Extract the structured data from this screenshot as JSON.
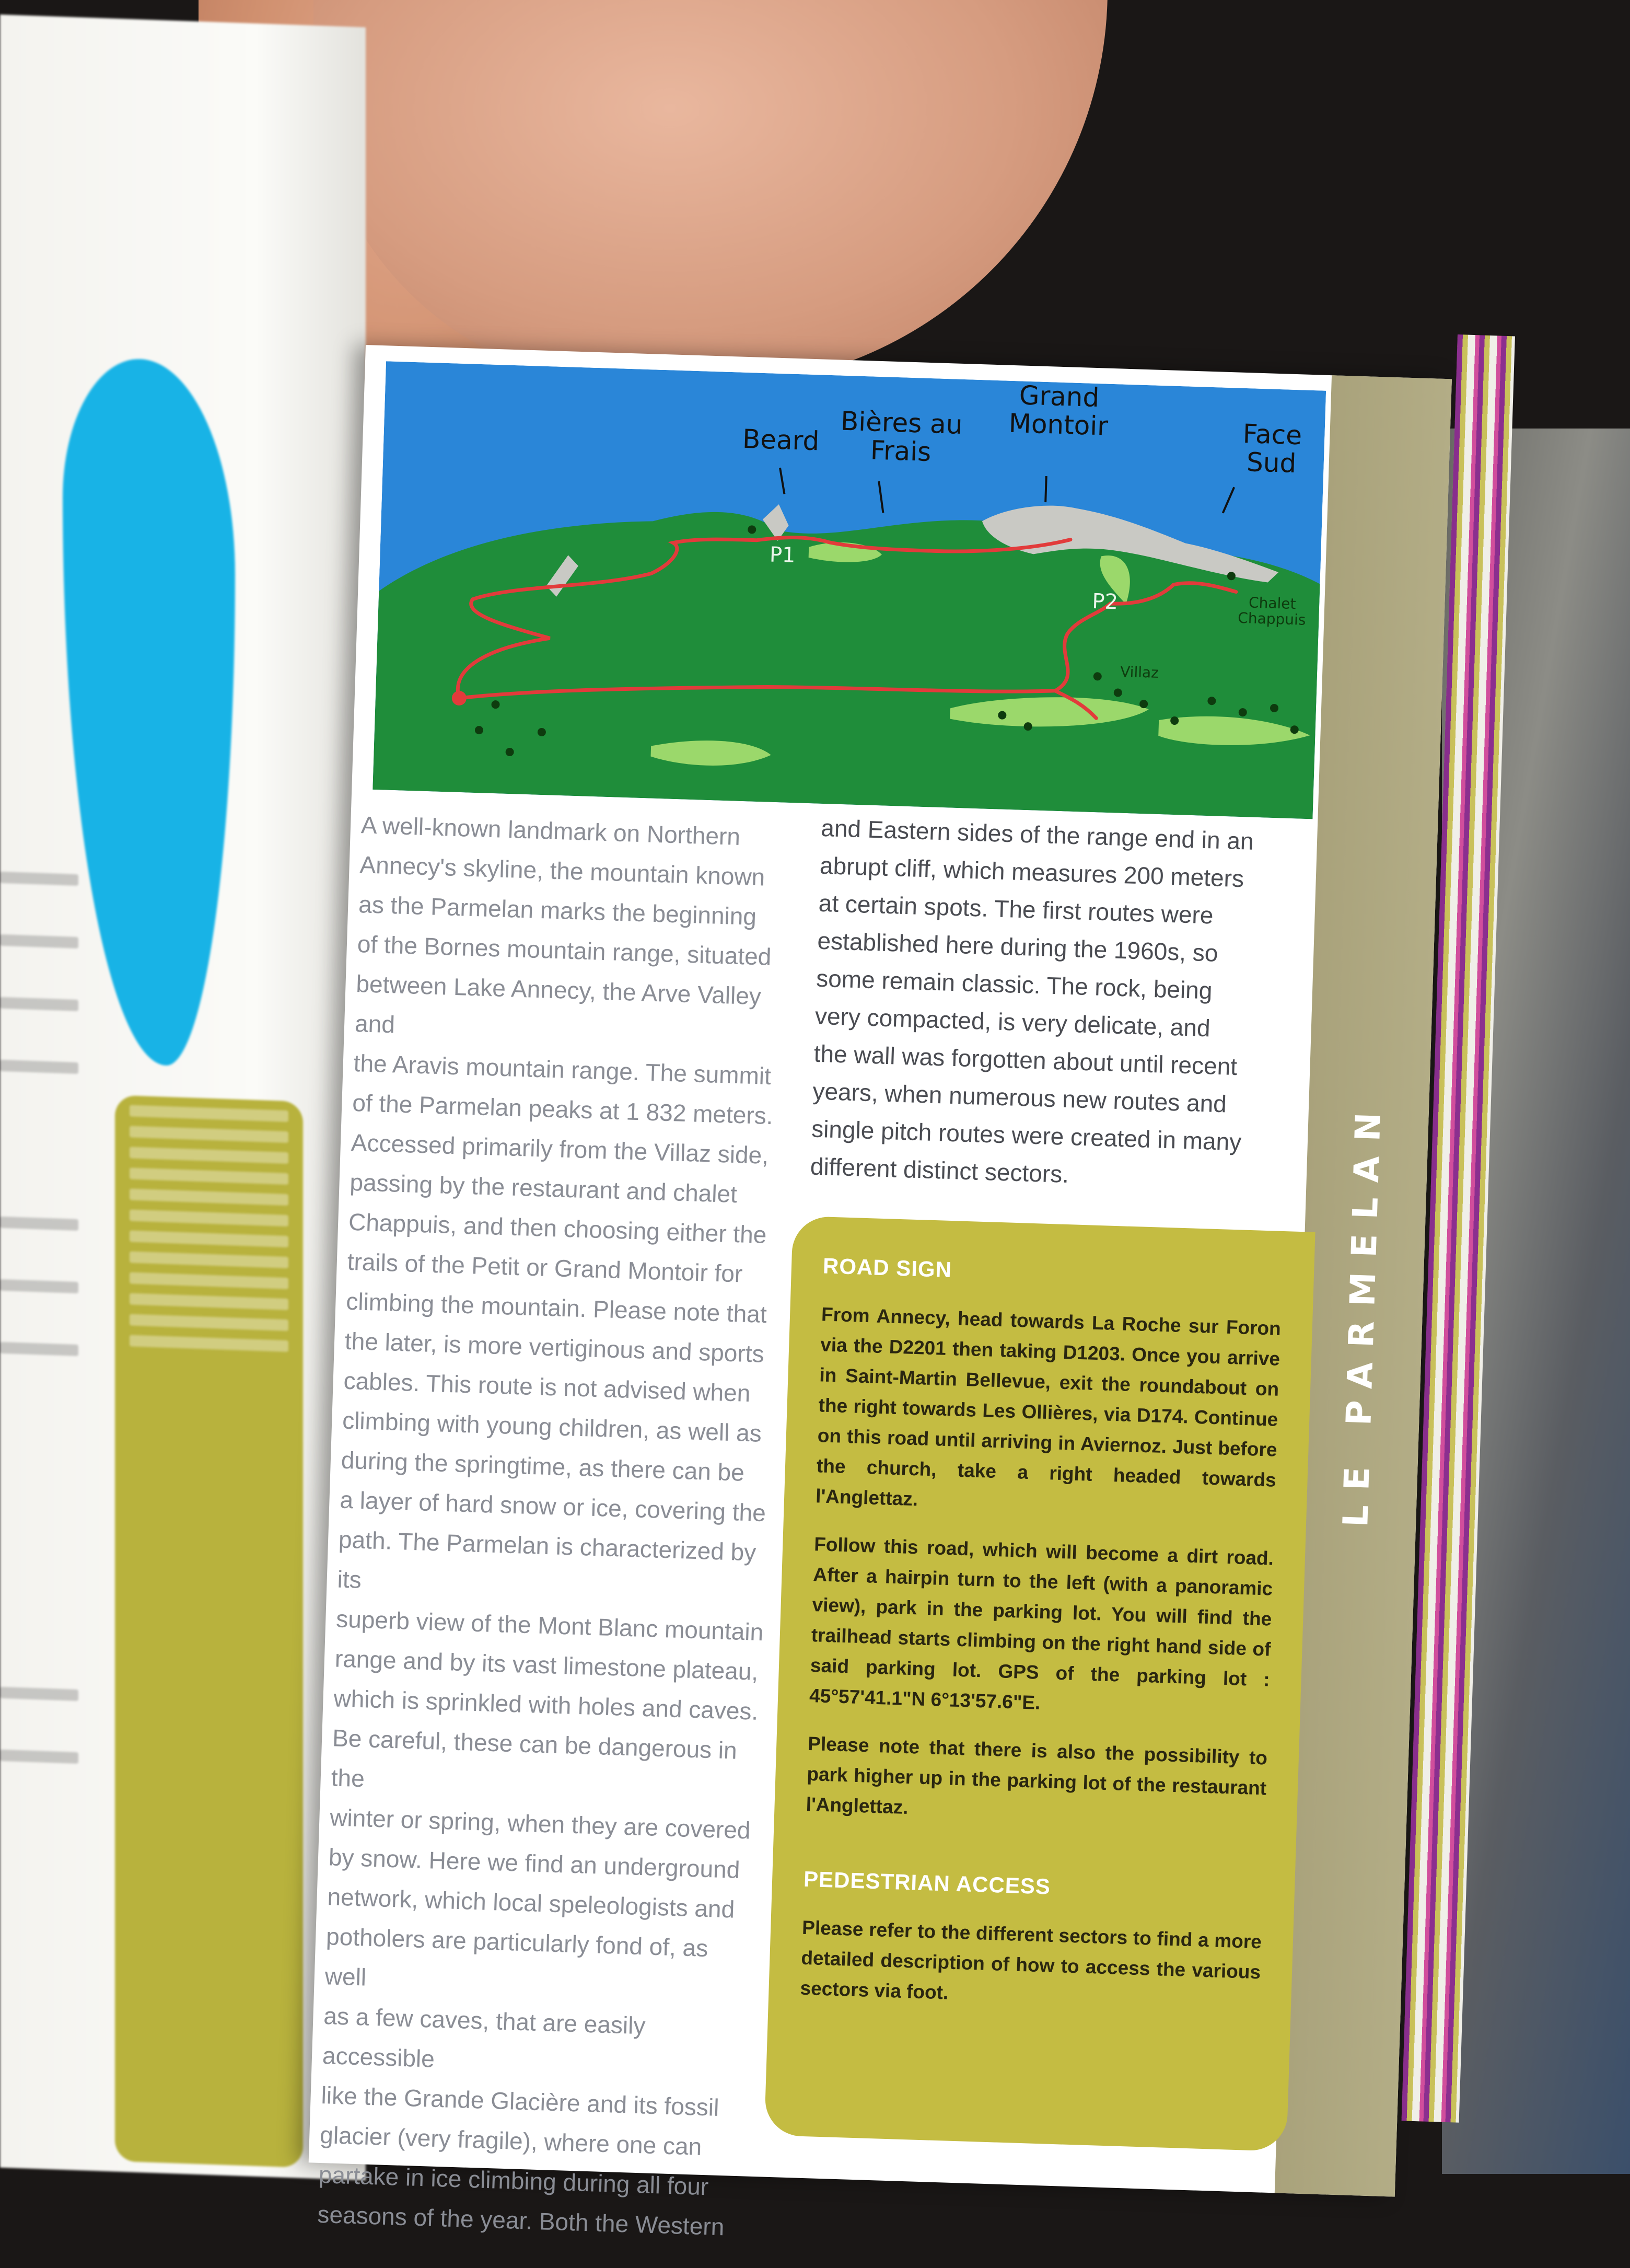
{
  "spine_title": "LE PARMELAN",
  "map": {
    "labels": {
      "beard": "Beard",
      "bieres": "Bières au\nFrais",
      "grand_montoir": "Grand\nMontoir",
      "face_sud": "Face\nSud",
      "p1": "P1",
      "p2": "P2",
      "chalet": "Chalet\nChappuis",
      "villaz": "Villaz"
    },
    "colors": {
      "sky": "#2a86d8",
      "forest": "#1f8d3a",
      "meadow": "#9bd86b",
      "rock": "#c9c9c4",
      "trail": "#e23b3b"
    }
  },
  "intro_text": "A well-known landmark on Northern\nAnnecy's skyline, the mountain known\nas the Parmelan marks the beginning\nof the Bornes mountain range, situated\nbetween Lake Annecy, the Arve Valley and\nthe Aravis mountain range. The summit\nof the Parmelan peaks at 1 832 meters.\nAccessed primarily from the Villaz side,\npassing by the restaurant and chalet\nChappuis, and then choosing either the\ntrails of the Petit or Grand Montoir for\nclimbing the mountain. Please note that\nthe later, is more vertiginous and sports\ncables. This route is not advised when\nclimbing with young children, as well as\nduring the springtime, as there can be\na layer of hard snow or ice, covering the\npath. The Parmelan is characterized by its\nsuperb view of the Mont Blanc mountain\nrange and by its vast limestone plateau,\nwhich is sprinkled with holes and caves.\nBe careful, these can be dangerous in the\nwinter or spring, when they are covered\nby snow. Here we find an underground\nnetwork, which local speleologists and\npotholers are particularly fond of, as well\nas a few caves, that are easily accessible\nlike the Grande Glacière and its fossil\nglacier (very fragile), where one can\npartake in ice climbing during all four\nseasons of the year. Both the Western",
  "continued_text": "and Eastern sides of the range end in an\nabrupt cliff, which measures 200 meters\nat certain spots. The first routes were\nestablished here during the 1960s, so\nsome remain classic. The rock, being\nvery compacted, is very delicate, and\nthe wall was forgotten about until recent\nyears, when numerous new routes and\nsingle pitch routes were created in many\ndifferent distinct sectors.",
  "road_sign": {
    "heading": "ROAD SIGN",
    "paragraphs": [
      "From Annecy, head towards La Roche sur Foron via the D2201 then taking D1203. Once you arrive in Saint-Martin Bellevue, exit the roundabout on the right towards Les Ollières, via D174. Continue on this road until arriving in Aviernoz. Just before the church, take a right headed towards l'Anglettaz.",
      "Follow this road, which will become a dirt road. After a hairpin turn to the left (with a panoramic view), park in the parking lot. You will find the trailhead starts climbing on the right hand side of said parking lot. GPS of the parking lot : 45°57'41.1\"N 6°13'57.6\"E.",
      "Please note that there is also the possibility to park higher up in the parking lot of the restaurant l'Anglettaz."
    ]
  },
  "pedestrian_access": {
    "heading": "PEDESTRIAN ACCESS",
    "paragraph": "Please refer to the different sectors to find a more detailed description of how to access the various sectors via foot."
  }
}
